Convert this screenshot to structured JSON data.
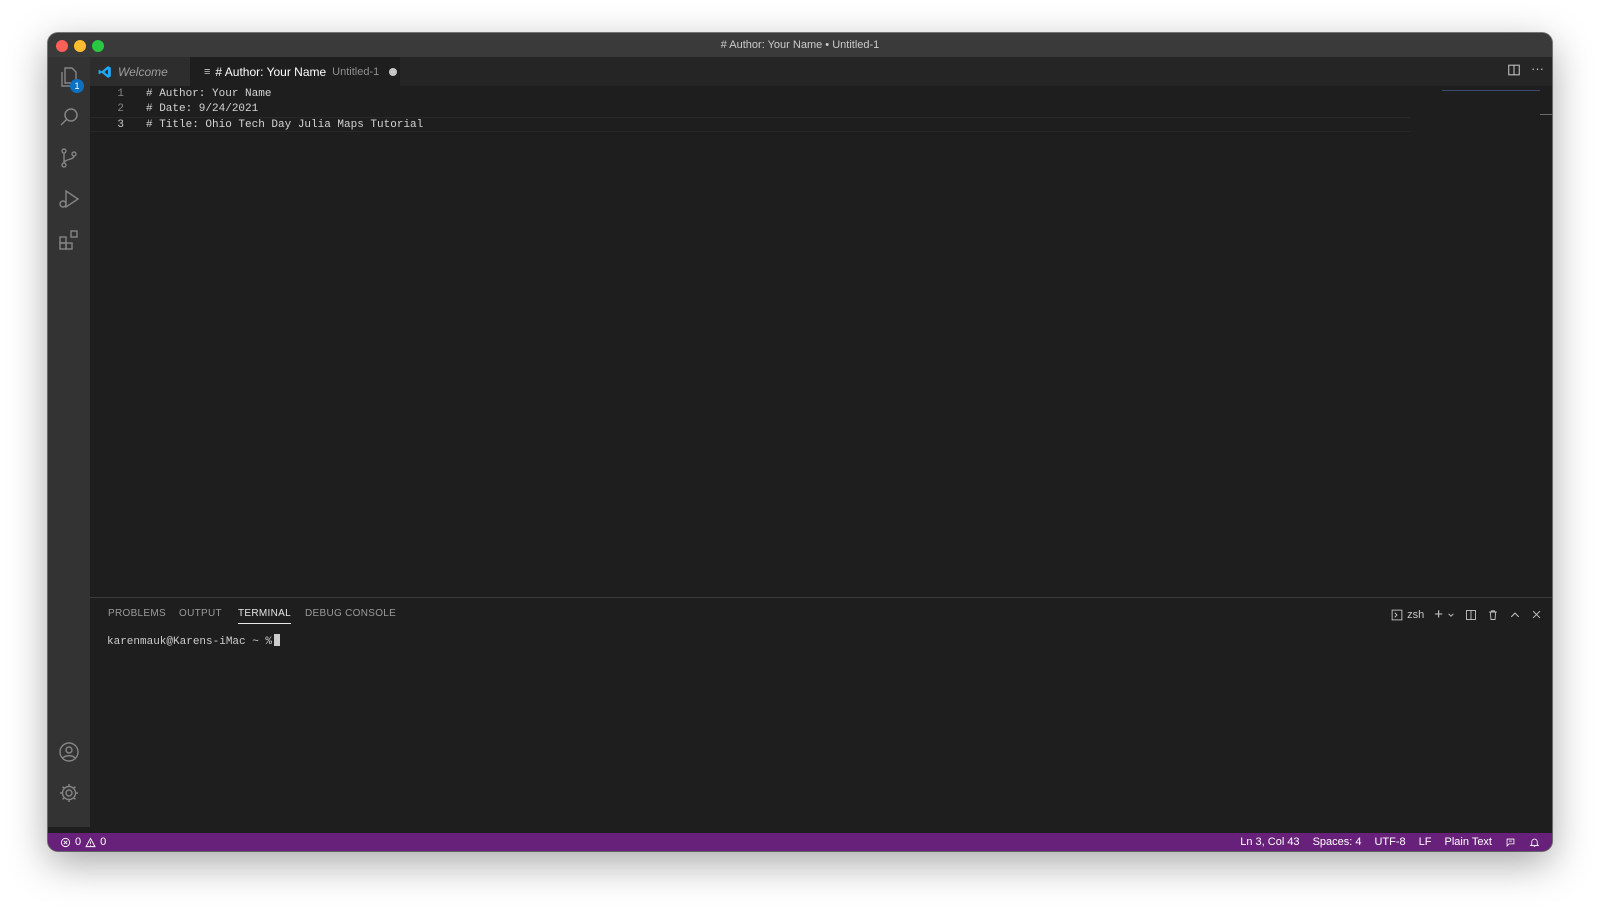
{
  "window": {
    "title": "# Author: Your Name • Untitled-1"
  },
  "activity_bar": {
    "items": [
      {
        "icon": "files-icon",
        "badge": "1"
      },
      {
        "icon": "search-icon"
      },
      {
        "icon": "source-control-icon"
      },
      {
        "icon": "run-debug-icon"
      },
      {
        "icon": "extensions-icon"
      }
    ],
    "bottom": [
      {
        "icon": "account-icon"
      },
      {
        "icon": "settings-gear-icon"
      }
    ]
  },
  "tabs": [
    {
      "label": "Welcome",
      "icon": "vscode-logo-icon"
    },
    {
      "label": "# Author: Your Name",
      "description": "Untitled-1",
      "icon": "plain-text-file-icon",
      "dirty": true,
      "active": true
    }
  ],
  "editor": {
    "lines": [
      {
        "num": "1",
        "text": "# Author: Your Name"
      },
      {
        "num": "2",
        "text": "# Date: 9/24/2021"
      },
      {
        "num": "3",
        "text": "# Title: Ohio Tech Day Julia Maps Tutorial"
      }
    ]
  },
  "panel": {
    "tabs": [
      "PROBLEMS",
      "OUTPUT",
      "TERMINAL",
      "DEBUG CONSOLE"
    ],
    "active_tab": "TERMINAL",
    "shell": "zsh",
    "terminal_prompt": "karenmauk@Karens-iMac ~ %"
  },
  "status_bar": {
    "errors": "0",
    "warnings": "0",
    "position": "Ln 3, Col 43",
    "spaces": "Spaces: 4",
    "encoding": "UTF-8",
    "eol": "LF",
    "language": "Plain Text",
    "color": "#68217a"
  }
}
